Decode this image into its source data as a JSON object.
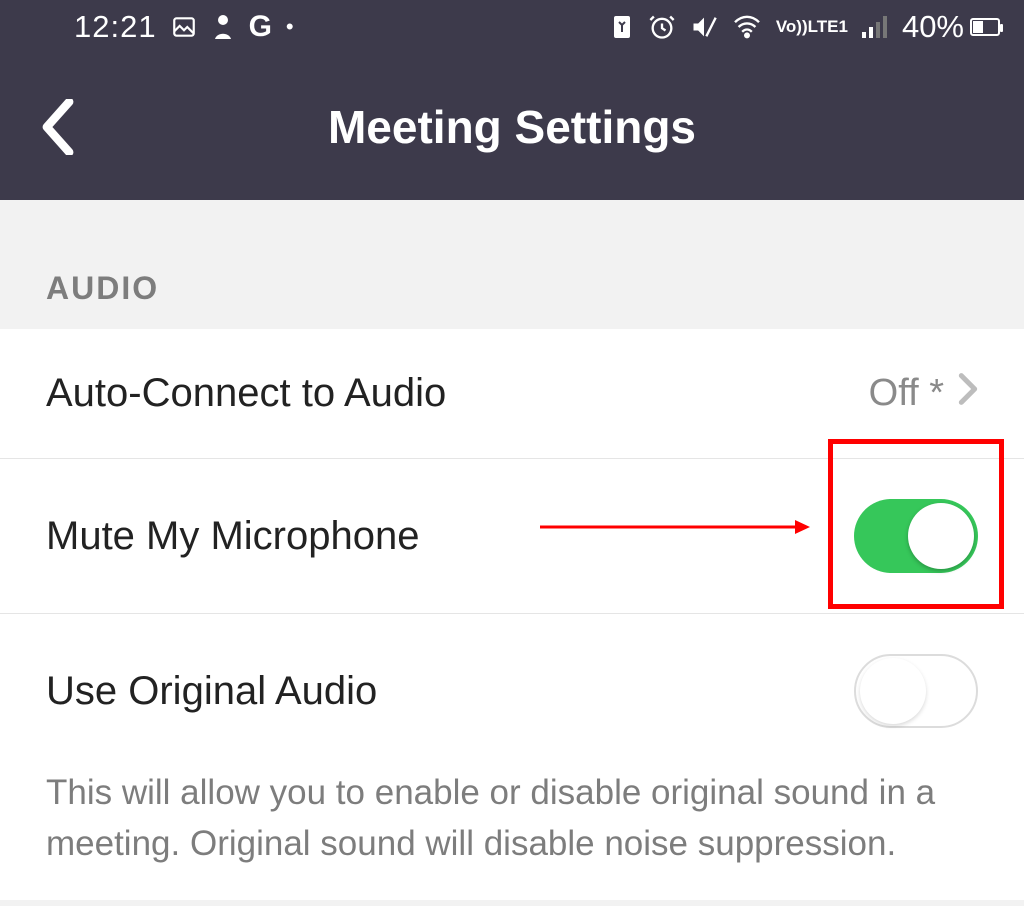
{
  "status": {
    "time": "12:21",
    "battery_pct": "40%",
    "icons_left": [
      "image-icon",
      "person-icon",
      "google-icon",
      "dot-icon"
    ],
    "icons_right": [
      "recycle-icon",
      "alarm-icon",
      "mute-icon",
      "wifi-icon"
    ],
    "lte_top": "Vo))",
    "lte_bottom": "LTE1"
  },
  "header": {
    "title": "Meeting Settings"
  },
  "section": {
    "audio_label": "AUDIO"
  },
  "rows": {
    "auto_connect": {
      "label": "Auto-Connect to Audio",
      "value": "Off *"
    },
    "mute_mic": {
      "label": "Mute My Microphone",
      "on": true
    },
    "orig_audio": {
      "label": "Use Original Audio",
      "on": false
    }
  },
  "desc": "This will allow you to enable or disable original sound in a meeting. Original sound will disable noise suppression."
}
